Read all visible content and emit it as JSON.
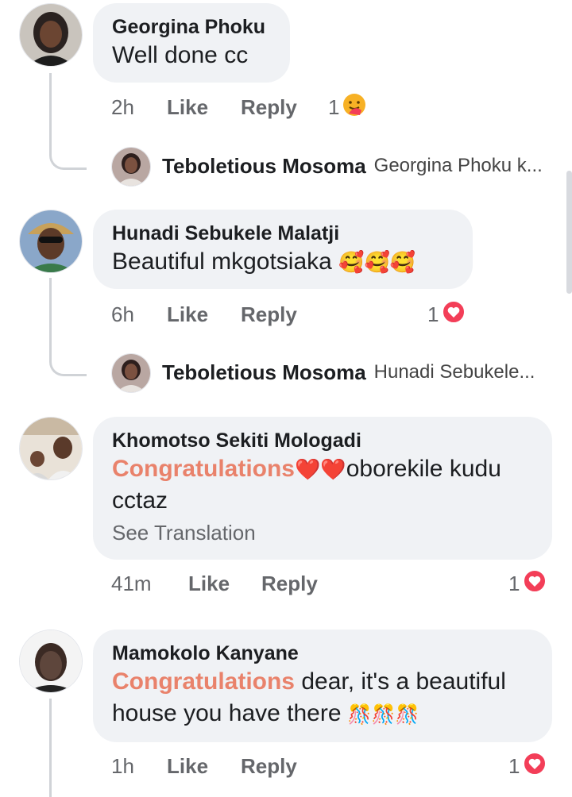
{
  "comments": [
    {
      "name": "Georgina Phoku",
      "text": "Well done cc",
      "time": "2h",
      "like": "Like",
      "reply": "Reply",
      "reaction_count": "1",
      "reaction_icon": "care-hug-emoji",
      "reply_preview": {
        "name": "Teboletious Mosoma",
        "text": "Georgina Phoku k..."
      }
    },
    {
      "name": "Hunadi Sebukele Malatji",
      "text": "Beautiful mkgotsiaka",
      "emojis": "🥰🥰🥰",
      "time": "6h",
      "like": "Like",
      "reply": "Reply",
      "reaction_count": "1",
      "reaction_icon": "love-heart",
      "reply_preview": {
        "name": "Teboletious Mosoma",
        "text": "Hunadi Sebukele..."
      }
    },
    {
      "name": "Khomotso Sekiti Mologadi",
      "highlight": "Congratulations",
      "emojis": "❤️❤️",
      "text_line1": "oborekile kudu",
      "text_line2": "cctaz",
      "see_translation": "See Translation",
      "time": "41m",
      "like": "Like",
      "reply": "Reply",
      "reaction_count": "1",
      "reaction_icon": "love-heart"
    },
    {
      "name": "Mamokolo Kanyane",
      "highlight": "Congratulations",
      "text_line1": " dear, it's a beautiful",
      "text_line2": "house you have there",
      "emojis": "🎊🎊🎊",
      "time": "1h",
      "like": "Like",
      "reply": "Reply",
      "reaction_count": "1",
      "reaction_icon": "love-heart"
    }
  ],
  "colors": {
    "bubble": "#f0f2f5",
    "highlight": "#e9826b",
    "love": "#f33e58",
    "care": "#f7b125",
    "meta": "#65676b"
  }
}
